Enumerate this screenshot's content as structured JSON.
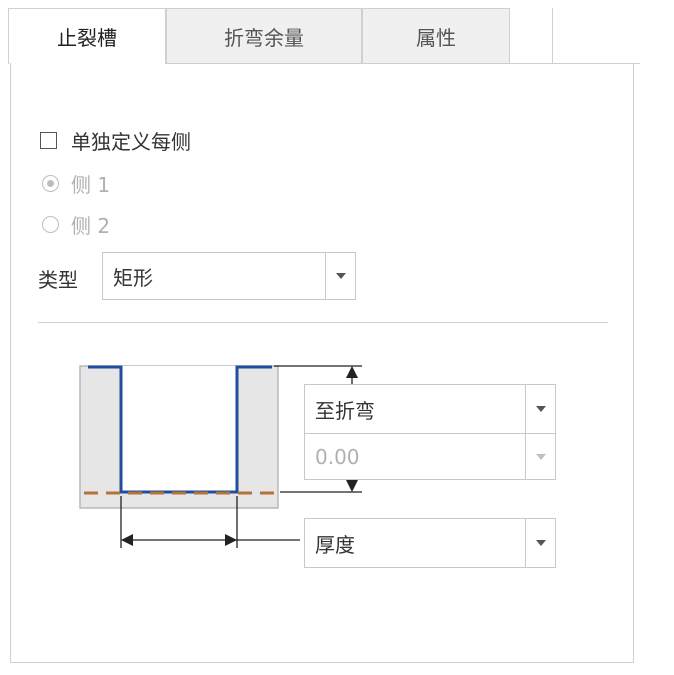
{
  "tabs": [
    {
      "label": "止裂槽",
      "active": true
    },
    {
      "label": "折弯余量",
      "active": false
    },
    {
      "label": "属性",
      "active": false
    }
  ],
  "options": {
    "define_each_side_label": "单独定义每侧",
    "define_each_side_checked": false,
    "side1_label": "侧 1",
    "side1_selected": true,
    "side2_label": "侧 2",
    "side2_selected": false
  },
  "type": {
    "label": "类型",
    "value": "矩形"
  },
  "depth": {
    "reference_value": "至折弯",
    "value_placeholder": "0.00"
  },
  "width": {
    "reference_value": "厚度"
  },
  "colors": {
    "profile_line": "#1f4e9c",
    "bend_line": "#b5733a",
    "part_fill": "#e6e6e6"
  }
}
